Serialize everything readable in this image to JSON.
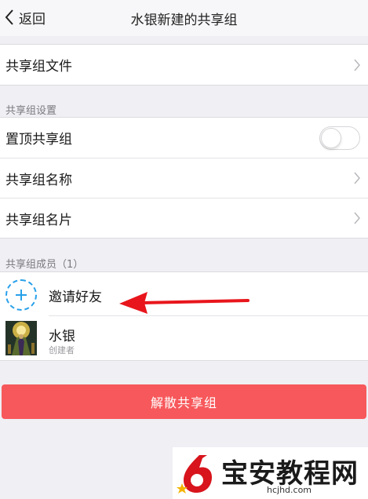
{
  "nav": {
    "back_label": "返回",
    "title": "水银新建的共享组"
  },
  "files_row": {
    "label": "共享组文件"
  },
  "settings": {
    "section_label": "共享组设置",
    "pin": {
      "label": "置顶共享组",
      "enabled": false
    },
    "name_row": {
      "label": "共享组名称"
    },
    "card_row": {
      "label": "共享组名片"
    }
  },
  "members": {
    "section_label": "共享组成员（1）",
    "invite_label": "邀请好友",
    "list": [
      {
        "name": "水银",
        "role": "创建者"
      }
    ]
  },
  "disband_button": "解散共享组",
  "watermark": {
    "title": "宝安教程网",
    "url": "hcjhd.com"
  },
  "colors": {
    "accent_blue": "#27a0ea",
    "danger_red": "#f7585b",
    "annotation_red": "#e8161c"
  }
}
